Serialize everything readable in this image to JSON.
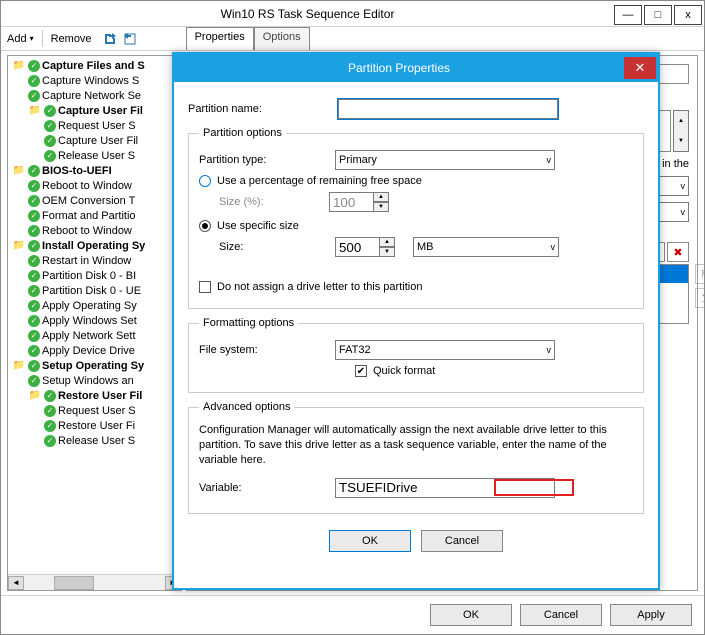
{
  "window": {
    "title": "Win10 RS Task Sequence Editor",
    "controls": {
      "min": "—",
      "max": "□",
      "close": "x"
    }
  },
  "toolbar": {
    "add": "Add",
    "remove": "Remove",
    "tabs": {
      "properties": "Properties",
      "options": "Options"
    }
  },
  "tree": [
    {
      "lvl": 0,
      "type": "group",
      "bold": true,
      "label": "Capture Files and S"
    },
    {
      "lvl": 1,
      "type": "step",
      "label": "Capture Windows S"
    },
    {
      "lvl": 1,
      "type": "step",
      "label": "Capture Network Se"
    },
    {
      "lvl": 1,
      "type": "group",
      "bold": true,
      "label": "Capture User Fil"
    },
    {
      "lvl": 2,
      "type": "step",
      "label": "Request User S"
    },
    {
      "lvl": 2,
      "type": "step",
      "label": "Capture User Fil"
    },
    {
      "lvl": 2,
      "type": "step",
      "label": "Release User S"
    },
    {
      "lvl": 0,
      "type": "group",
      "bold": true,
      "label": "BIOS-to-UEFI"
    },
    {
      "lvl": 1,
      "type": "step",
      "label": "Reboot to Window"
    },
    {
      "lvl": 1,
      "type": "step",
      "label": "OEM Conversion T"
    },
    {
      "lvl": 1,
      "type": "step",
      "label": "Format and Partitio"
    },
    {
      "lvl": 1,
      "type": "step",
      "label": "Reboot to Window"
    },
    {
      "lvl": 0,
      "type": "group",
      "bold": true,
      "label": "Install Operating Sy"
    },
    {
      "lvl": 1,
      "type": "step",
      "label": "Restart in Window"
    },
    {
      "lvl": 1,
      "type": "step",
      "label": "Partition Disk 0 - BI"
    },
    {
      "lvl": 1,
      "type": "step",
      "label": "Partition Disk 0 - UE"
    },
    {
      "lvl": 1,
      "type": "step",
      "label": "Apply Operating Sy"
    },
    {
      "lvl": 1,
      "type": "step",
      "label": "Apply Windows Set"
    },
    {
      "lvl": 1,
      "type": "step",
      "label": "Apply Network Sett"
    },
    {
      "lvl": 1,
      "type": "step",
      "label": "Apply Device Drive"
    },
    {
      "lvl": 0,
      "type": "group",
      "bold": true,
      "label": "Setup Operating Sy"
    },
    {
      "lvl": 1,
      "type": "step",
      "label": "Setup Windows an"
    },
    {
      "lvl": 1,
      "type": "group",
      "bold": true,
      "label": "Restore User Fil"
    },
    {
      "lvl": 2,
      "type": "step",
      "label": "Request User S"
    },
    {
      "lvl": 2,
      "type": "step",
      "label": "Restore User Fi"
    },
    {
      "lvl": 2,
      "type": "step",
      "label": "Release User S"
    }
  ],
  "right_panel": {
    "hint": "layout to use in the"
  },
  "buttons": {
    "ok": "OK",
    "cancel": "Cancel",
    "apply": "Apply"
  },
  "dialog": {
    "title": "Partition Properties",
    "name_label": "Partition name:",
    "name_value": "",
    "options_legend": "Partition options",
    "type_label": "Partition type:",
    "type_value": "Primary",
    "pct_radio": "Use a percentage of remaining free space",
    "size_pct_label": "Size (%):",
    "size_pct_value": "100",
    "size_radio": "Use specific size",
    "size_label": "Size:",
    "size_value": "500",
    "size_unit": "MB",
    "no_letter": "Do not assign a drive letter to this partition",
    "fmt_legend": "Formatting options",
    "fs_label": "File system:",
    "fs_value": "FAT32",
    "quick": "Quick format",
    "adv_legend": "Advanced options",
    "adv_text": "Configuration Manager will automatically assign the next available drive letter to this partition. To save this drive letter as a task sequence variable, enter the name of the variable here.",
    "var_label": "Variable:",
    "var_value": "TSUEFIDrive",
    "ok": "OK",
    "cancel": "Cancel"
  }
}
